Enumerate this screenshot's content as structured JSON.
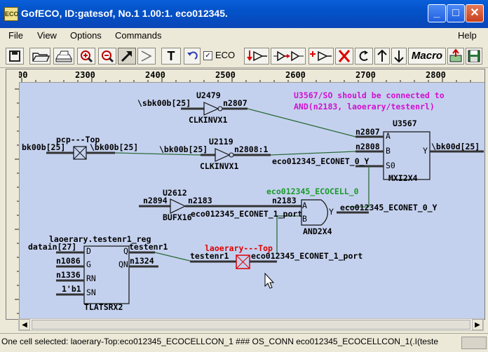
{
  "window": {
    "title": "GofECO, ID:gatesof, No.1 1.00:1. eco012345.",
    "icon_text": "ECO",
    "minimize_glyph": "_",
    "maximize_glyph": "□",
    "close_glyph": "✕"
  },
  "menu": {
    "file": "File",
    "view": "View",
    "options": "Options",
    "commands": "Commands",
    "help": "Help"
  },
  "toolbar": {
    "eco_checkbox_label": "ECO",
    "eco_checked": true,
    "text_tool": "T",
    "macro_label": "Macro"
  },
  "ruler": {
    "ticks": [
      "2300",
      "2400",
      "2500",
      "2600",
      "2700",
      "2800"
    ],
    "left_partial": "00"
  },
  "schematic": {
    "note_line1": "U3567/SO should be connected to",
    "note_line2": "AND(n2183, laoerary/testenrl)",
    "u2479": {
      "name": "U2479",
      "type": "CLKINVX1",
      "in_net": "\\sbk00b[25]",
      "out_net": "n2807"
    },
    "u2119": {
      "name": "U2119",
      "type": "CLKINVX1",
      "in_net": "\\bk00b[25]",
      "out_net": "n2808:1"
    },
    "u3567": {
      "name": "U3567",
      "type": "MXI2X4",
      "pin_a": "A",
      "pin_b": "B",
      "pin_s0": "S0",
      "pin_y": "Y",
      "net_a": "n2807",
      "net_b": "n2808",
      "net_s0": "eco012345_ECONET_0_Y",
      "net_y": "\\bk00d[25]"
    },
    "pcp": {
      "name": "pcp---Top",
      "left_net": "bk00b[25]",
      "right_net": "\\bk00b[25]"
    },
    "u2612": {
      "name": "U2612",
      "type": "BUFX16",
      "in_net": "n2894",
      "out_net": "n2183"
    },
    "and": {
      "name": "eco012345_ECOCELL_0",
      "type": "AND2X4",
      "pin_a": "A",
      "pin_b": "B",
      "pin_y": "Y",
      "net_a": "n2183",
      "net_b": "eco012345_ECONET_1_port",
      "net_y": "eco012345_ECONET_0_Y"
    },
    "latch": {
      "name": "laoerary.testenr1_reg",
      "type": "TLATSRX2",
      "pin_d": "D",
      "pin_g": "G",
      "pin_rn": "RN",
      "pin_sn": "SN",
      "pin_q": "Q",
      "pin_qn": "QN",
      "net_d": "datain[27]",
      "net_g": "n1086",
      "net_rn": "n1336",
      "net_sn": "1'b1",
      "net_q": "testenr1",
      "net_qn": "n1324"
    },
    "laoerary": {
      "name": "laoerary---Top",
      "left_net": "testenr1",
      "right_net": "eco012345_ECONET_1_port"
    }
  },
  "status": {
    "text": "One cell selected: laoerary-Top:eco012345_ECOCELLCON_1 ### OS_CONN eco012345_ECOCELLCON_1(.I(teste"
  },
  "colors": {
    "canvas_bg": "#c4d1ee",
    "wire": "#2b6b3a",
    "note": "#d10fd1",
    "selected_label": "#e00000",
    "eco_cell_label": "#1a9a2a"
  }
}
